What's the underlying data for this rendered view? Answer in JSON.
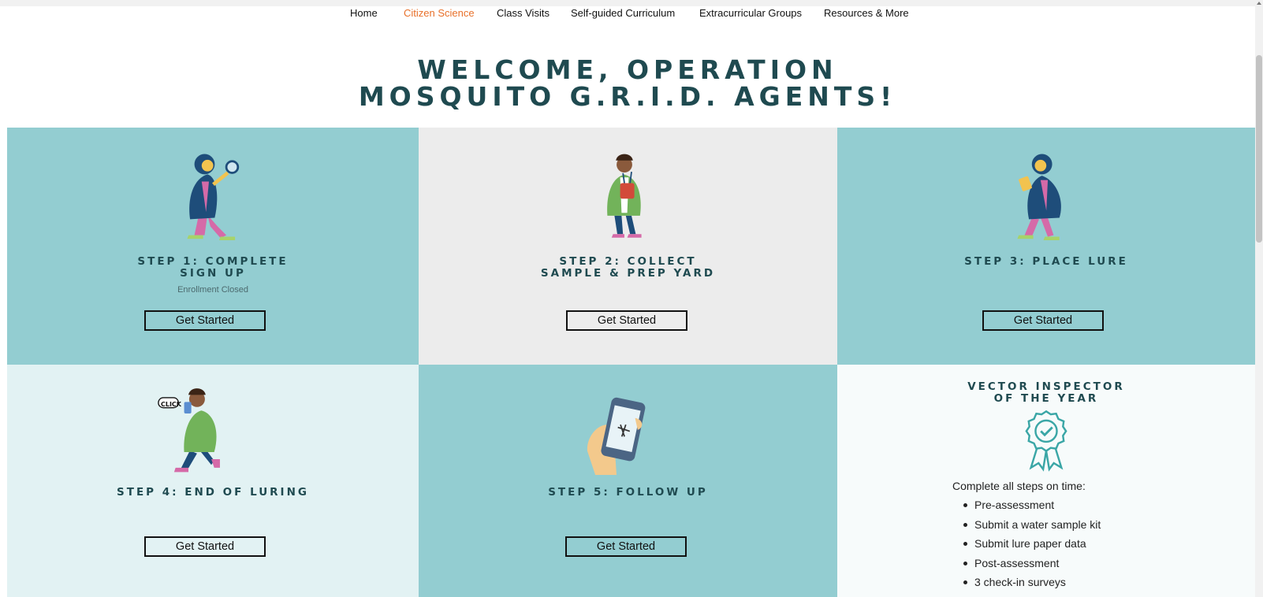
{
  "nav": {
    "items": [
      {
        "label": "Home",
        "active": false
      },
      {
        "label": "Citizen Science",
        "active": true
      },
      {
        "label": "Class Visits",
        "active": false
      },
      {
        "label": "Self-guided Curriculum",
        "active": false
      },
      {
        "label": "Extracurricular Groups",
        "active": false
      },
      {
        "label": "Resources & More",
        "active": false
      }
    ]
  },
  "hero": {
    "line1": "WELCOME, OPERATION",
    "line2": "MOSQUITO G.R.I.D. AGENTS!"
  },
  "steps": [
    {
      "title_line1": "STEP 1: COMPLETE",
      "title_line2": "SIGN UP",
      "note": "Enrollment Closed",
      "button": "Get Started"
    },
    {
      "title_line1": "STEP 2: COLLECT",
      "title_line2": "SAMPLE & PREP YARD",
      "button": "Get Started"
    },
    {
      "title_line1": "STEP 3: PLACE LURE",
      "button": "Get Started"
    },
    {
      "title_line1": "STEP 4: END OF LURING",
      "button": "Get Started",
      "sound_text": "CLICK"
    },
    {
      "title_line1": "STEP 5: FOLLOW UP",
      "button": "Get Started"
    }
  ],
  "award": {
    "title_line1": "VECTOR INSPECTOR",
    "title_line2": "OF THE YEAR",
    "intro": "Complete all steps on time:",
    "items": [
      "Pre-assessment",
      "Submit a water sample kit",
      "Submit lure paper data",
      "Post-assessment",
      "3 check-in surveys"
    ]
  },
  "colors": {
    "teal": "#93cdd1",
    "gray": "#ececec",
    "light": "#e2f2f3",
    "heading": "#1f4a50",
    "active_nav": "#e8702a"
  },
  "icons": [
    "magnifier-agent-illustration",
    "sample-agent-illustration",
    "lure-agent-illustration",
    "camera-agent-illustration",
    "phone-mosquito-illustration",
    "award-ribbon-icon"
  ]
}
